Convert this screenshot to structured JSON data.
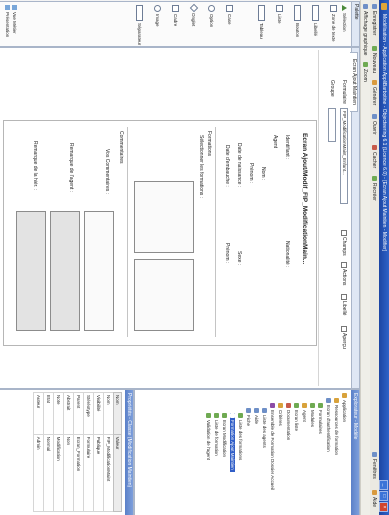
{
  "window": {
    "title": "Modélisation - Application AppliBarbotine - Objecteering 6.1 (Licence 6.0) - [Ecran Ajout Maintien - Modifier]",
    "buttons": [
      "_",
      "□",
      "×"
    ]
  },
  "toolbar": {
    "items": [
      "Enregistrer",
      "Nouveau",
      "Générer",
      "Ouvrir",
      "Cacher",
      "Recréer"
    ],
    "right_items": [
      "Fenêtres",
      "Aide"
    ]
  },
  "toolbar2": {
    "items": [
      "Affichage graphique",
      "Zoom"
    ]
  },
  "palette": {
    "header": "Palette",
    "items": [
      "Sélection",
      "Zone de texte",
      "Libellé",
      "Bouton",
      "Liste",
      "Tableau",
      "Case",
      "Option",
      "Onglet",
      "Cadre",
      "Image",
      "Séparateur"
    ],
    "bottom": [
      "Vue Métier",
      "Présentation"
    ]
  },
  "editor": {
    "tab": "Ecran Ajout Maintien",
    "filter": {
      "label": "Formulaire",
      "value": "FIP_ModificationMaint_Enfant...",
      "group_label": "Groupe",
      "checks": [
        "Champs",
        "Actions",
        "Libellé",
        "Aperçu"
      ]
    },
    "form": {
      "title": "Ecran Ajout/Modif_FIP_ModificationMain...",
      "fields": [
        "Identifiant :",
        "Agent",
        "Nom :",
        "Prénom :",
        "Date de naissance :",
        "Date d'embauche :",
        "Nationalité :",
        "Sexe :",
        "Prénom :"
      ],
      "section_formations": "Formations",
      "formations_label": "Sélectionner les formations :",
      "section_commentaires": "Commentaires",
      "comment_fields": [
        "Vos Commentaires :",
        "Remarque de l'agent :",
        "Remarque de la hiér. :"
      ]
    }
  },
  "tree": {
    "header": "Explorateur - Modèle",
    "items": [
      {
        "label": "Application",
        "level": 0
      },
      {
        "label": "Ressources de formation",
        "level": 1
      },
      {
        "label": "Ecran d'authentification",
        "level": 1
      },
      {
        "label": "Formulaires",
        "level": 2
      },
      {
        "label": "Modules",
        "level": 2
      },
      {
        "label": "Agent",
        "level": 2
      },
      {
        "label": "Ecran liste",
        "level": 2
      },
      {
        "label": "Documentation",
        "level": 2
      },
      {
        "label": "Critères",
        "level": 2
      },
      {
        "label": "Ensemble de Formation Dossier Accueil",
        "level": 2
      },
      {
        "label": "Liste des agents",
        "level": 3
      },
      {
        "label": "Aide",
        "level": 3
      },
      {
        "label": "Fiche",
        "level": 3
      },
      {
        "label": "Liste des formations",
        "level": 4
      },
      {
        "label": "Formation Ajout Maintien",
        "level": 4,
        "selected": true
      },
      {
        "label": "Ecran Modification",
        "level": 4
      },
      {
        "label": "Liste de formation",
        "level": 4
      },
      {
        "label": "Validation de l'agent",
        "level": 4
      }
    ]
  },
  "props": {
    "header": "Propriétés - Classe (Modification Maintien)",
    "columns": [
      "Nom",
      "Valeur"
    ],
    "rows": [
      [
        "Nom",
        "FIP_ModificationMaint"
      ],
      [
        "Visibilité",
        "Publique"
      ],
      [
        "Stéréotype",
        "Formulaire"
      ],
      [
        "Parent",
        "Ecran_Formation"
      ],
      [
        "Abstrait",
        "Non"
      ],
      [
        "Note",
        "Modification"
      ],
      [
        "Etat",
        "Normal"
      ],
      [
        "Auteur",
        "Admin"
      ]
    ]
  }
}
